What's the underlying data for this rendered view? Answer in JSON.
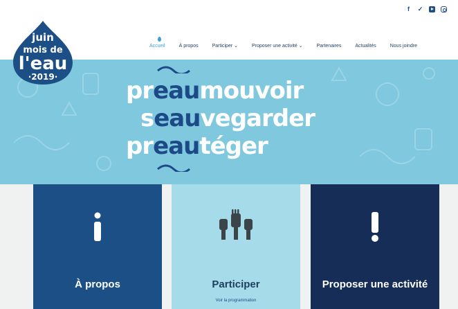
{
  "social": [
    "facebook-icon",
    "twitter-icon",
    "youtube-icon",
    "instagram-icon"
  ],
  "logo": {
    "line1": "juin",
    "line2": "mois de",
    "line3": "l'eau",
    "year": "·2019·"
  },
  "nav": [
    {
      "label": "Accueil",
      "active": true
    },
    {
      "label": "À propos",
      "active": false
    },
    {
      "label": "Participer ⌄",
      "active": false
    },
    {
      "label": "Proposer une activité ⌄",
      "active": false
    },
    {
      "label": "Partenaires",
      "active": false
    },
    {
      "label": "Actualités",
      "active": false
    },
    {
      "label": "Nous joindre",
      "active": false
    }
  ],
  "hero": {
    "line1_dark": "pr",
    "line1_eau": "eau",
    "line1_rest": "mouvoir",
    "line2_dark": "s",
    "line2_eau": "eau",
    "line2_rest": "vegarder",
    "line3_dark": "pr",
    "line3_eau": "eau",
    "line3_rest": "téger"
  },
  "cards": [
    {
      "title": "À propos",
      "icon": "info-icon"
    },
    {
      "title": "Participer",
      "subtitle": "Voir la programmation",
      "icon": "raised-hands-icon"
    },
    {
      "title": "Proposer une activité",
      "icon": "exclamation-icon"
    }
  ],
  "colors": {
    "primary": "#1b4f86",
    "hero": "#7fc8de",
    "dark": "#162e57",
    "accent": "#3aa0d8"
  }
}
